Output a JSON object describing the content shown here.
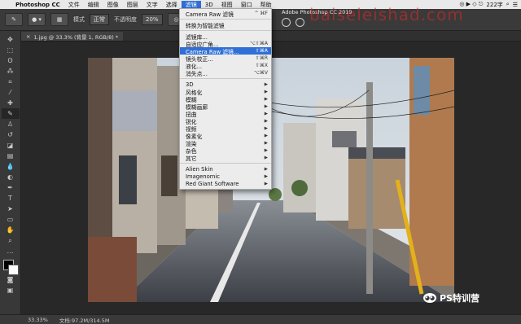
{
  "menubar": {
    "app": "Photoshop CC",
    "items": [
      "文件",
      "编辑",
      "图像",
      "图层",
      "文字",
      "选择",
      "滤镜",
      "3D",
      "视图",
      "窗口",
      "帮助"
    ],
    "active_index": 6,
    "battery": "222字",
    "status_icons": "◎ ▶ ◇ ⎋"
  },
  "options": {
    "mode_label": "模式",
    "mode_value": "正常",
    "opacity_label": "不透明度",
    "opacity_value": "20%",
    "angle_value": "0°"
  },
  "document_tab": {
    "title": "1.jpg @ 33.3% (背景 1, RGB/8) *",
    "close": "×"
  },
  "overlay": {
    "window_title": "Adobe Photoshop CC 2019",
    "watermark": "baiseleishad.com"
  },
  "filter_menu": {
    "items": [
      {
        "label": "Camera Raw 滤镜",
        "shortcut": "^ ⌘F",
        "type": "item"
      },
      {
        "type": "sep"
      },
      {
        "label": "转换为智能滤镜",
        "shortcut": "",
        "type": "item"
      },
      {
        "type": "sep"
      },
      {
        "label": "滤镜库...",
        "shortcut": "",
        "type": "item"
      },
      {
        "label": "自适应广角...",
        "shortcut": "⌥⇧⌘A",
        "type": "item"
      },
      {
        "label": "Camera Raw 滤镜...",
        "shortcut": "⇧⌘A",
        "type": "highlight"
      },
      {
        "label": "镜头校正...",
        "shortcut": "⇧⌘R",
        "type": "item"
      },
      {
        "label": "液化...",
        "shortcut": "⇧⌘X",
        "type": "item"
      },
      {
        "label": "消失点...",
        "shortcut": "⌥⌘V",
        "type": "item"
      },
      {
        "type": "sep"
      },
      {
        "label": "3D",
        "type": "sub"
      },
      {
        "label": "风格化",
        "type": "sub"
      },
      {
        "label": "模糊",
        "type": "sub"
      },
      {
        "label": "模糊画廊",
        "type": "sub"
      },
      {
        "label": "扭曲",
        "type": "sub"
      },
      {
        "label": "锐化",
        "type": "sub"
      },
      {
        "label": "视频",
        "type": "sub"
      },
      {
        "label": "像素化",
        "type": "sub"
      },
      {
        "label": "渲染",
        "type": "sub"
      },
      {
        "label": "杂色",
        "type": "sub"
      },
      {
        "label": "其它",
        "type": "sub"
      },
      {
        "type": "sep"
      },
      {
        "label": "Alien Skin",
        "type": "sub"
      },
      {
        "label": "Imagenomic",
        "type": "sub"
      },
      {
        "label": "Red Giant Software",
        "type": "sub"
      }
    ]
  },
  "status": {
    "zoom": "33.33%",
    "doc": "文档:97.2M/314.5M"
  },
  "brand": {
    "name": "PS特训营"
  },
  "tools": [
    "move-icon",
    "marquee-icon",
    "lasso-icon",
    "quick-select-icon",
    "crop-icon",
    "eyedropper-icon",
    "healing-icon",
    "brush-icon",
    "stamp-icon",
    "history-brush-icon",
    "eraser-icon",
    "gradient-icon",
    "blur-icon",
    "dodge-icon",
    "pen-icon",
    "type-icon",
    "path-select-icon",
    "shape-icon",
    "hand-icon",
    "zoom-icon"
  ]
}
